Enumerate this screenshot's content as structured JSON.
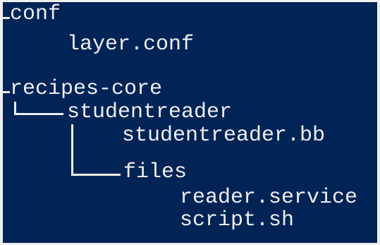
{
  "window": {
    "background_color": "#012456",
    "text_color": "#eeedf0"
  },
  "tree": {
    "conf_label": "conf",
    "layer_conf_label": "layer.conf",
    "recipes_core_label": "recipes-core",
    "studentreader_dir_label": "studentreader",
    "studentreader_bb_label": "studentreader.bb",
    "files_dir_label": "files",
    "reader_service_label": "reader.service",
    "script_sh_label": "script.sh"
  }
}
